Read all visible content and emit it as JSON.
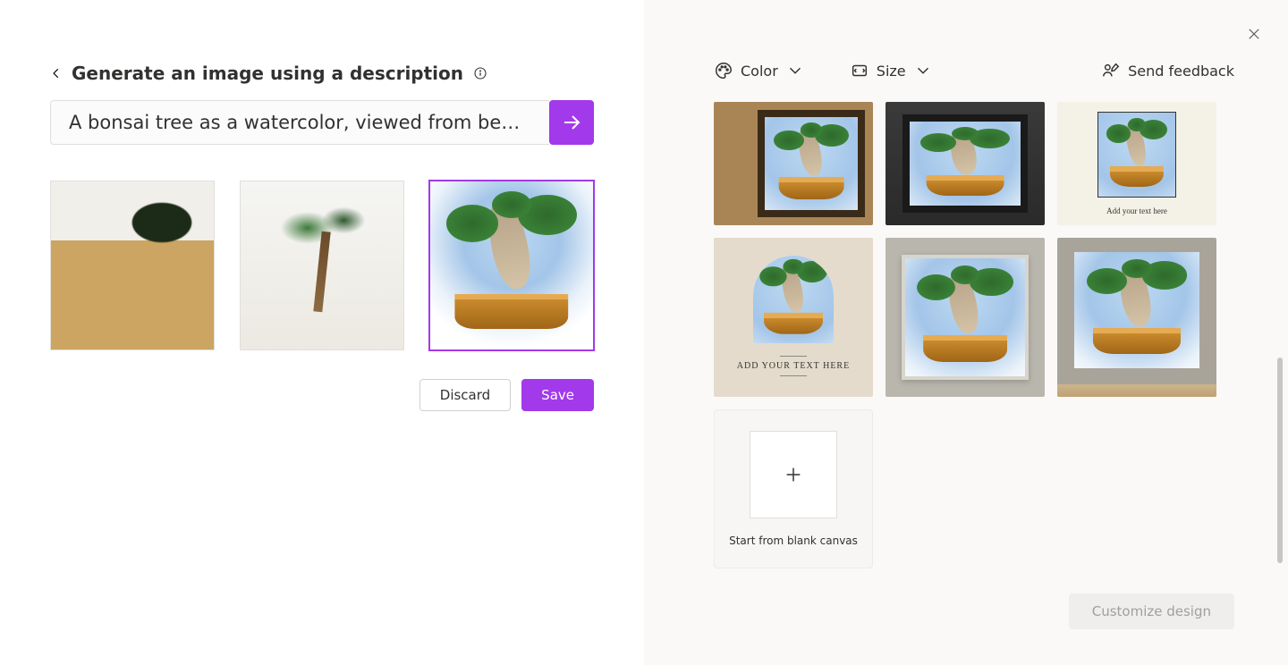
{
  "left": {
    "page_title": "Generate an image using a description",
    "prompt_value": "A bonsai tree as a watercolor, viewed from be…",
    "discard_label": "Discard",
    "save_label": "Save"
  },
  "right": {
    "color_label": "Color",
    "size_label": "Size",
    "feedback_label": "Send feedback",
    "template3_text": "Add your text here",
    "template4_text": "ADD YOUR TEXT HERE",
    "blank_canvas_label": "Start from blank canvas",
    "customize_label": "Customize design"
  },
  "colors": {
    "accent": "#a239ea",
    "annotation": "#00b4ef"
  }
}
